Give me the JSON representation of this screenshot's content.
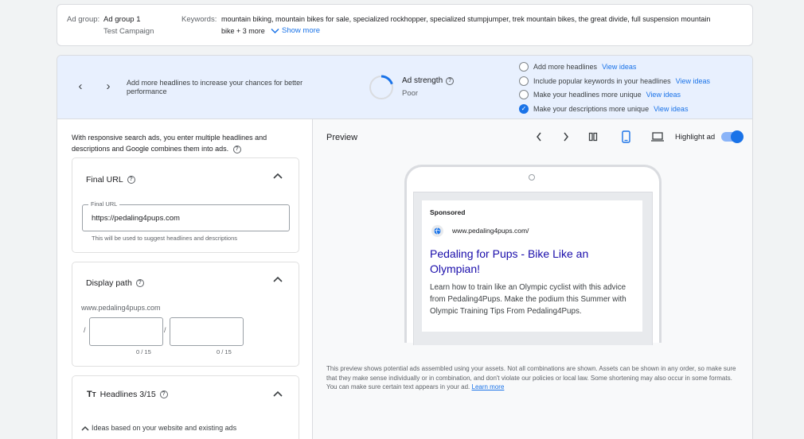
{
  "top": {
    "ad_group_label": "Ad group:",
    "ad_group_value": "Ad group 1",
    "campaign": "Test Campaign",
    "keywords_label": "Keywords:",
    "keywords_line1": "mountain biking, mountain bikes for sale, specialized rockhopper, specialized stumpjumper, trek mountain bikes, the great divide, full suspension mountain",
    "keywords_line2": "bike + 3 more",
    "show_more": "Show more"
  },
  "strength": {
    "tip": "Add more headlines to increase your chances for better performance",
    "label": "Ad strength",
    "value": "Poor",
    "progress": 0.2,
    "suggestions": [
      {
        "text": "Add more headlines",
        "link": "View ideas",
        "checked": false
      },
      {
        "text": "Include popular keywords in your headlines",
        "link": "View ideas",
        "checked": false
      },
      {
        "text": "Make your headlines more unique",
        "link": "View ideas",
        "checked": false
      },
      {
        "text": "Make your descriptions more unique",
        "link": "View ideas",
        "checked": true
      }
    ]
  },
  "left": {
    "intro": "With responsive search ads, you enter multiple headlines and descriptions and Google combines them into ads.",
    "final_url": {
      "title": "Final URL",
      "field_label": "Final URL",
      "value": "https://pedaling4pups.com",
      "hint": "This will be used to suggest headlines and descriptions"
    },
    "display_path": {
      "title": "Display path",
      "domain": "www.pedaling4pups.com",
      "sep": "/",
      "counter1": "0 / 15",
      "counter2": "0 / 15"
    },
    "headlines": {
      "title": "Headlines 3/15",
      "ideas": "Ideas based on your website and existing ads"
    }
  },
  "preview": {
    "title": "Preview",
    "highlight_label": "Highlight ad",
    "highlight_on": true,
    "ad": {
      "sponsored": "Sponsored",
      "url": "www.pedaling4pups.com/",
      "headline": "Pedaling for Pups - Bike Like an Olympian!",
      "description": "Learn how to train like an Olympic cyclist with this advice from Pedaling4Pups. Make the podium this Summer with Olympic Training Tips From Pedaling4Pups."
    },
    "disclaimer": "This preview shows potential ads assembled using your assets. Not all combinations are shown. Assets can be shown in any order, so make sure that they make sense individually or in combination, and don't violate our policies or local law. Some shortening may also occur in some formats. You can make sure certain text appears in your ad.",
    "learn_more": "Learn more"
  },
  "colors": {
    "accent": "#1a73e8",
    "band": "#e8f0fe"
  }
}
